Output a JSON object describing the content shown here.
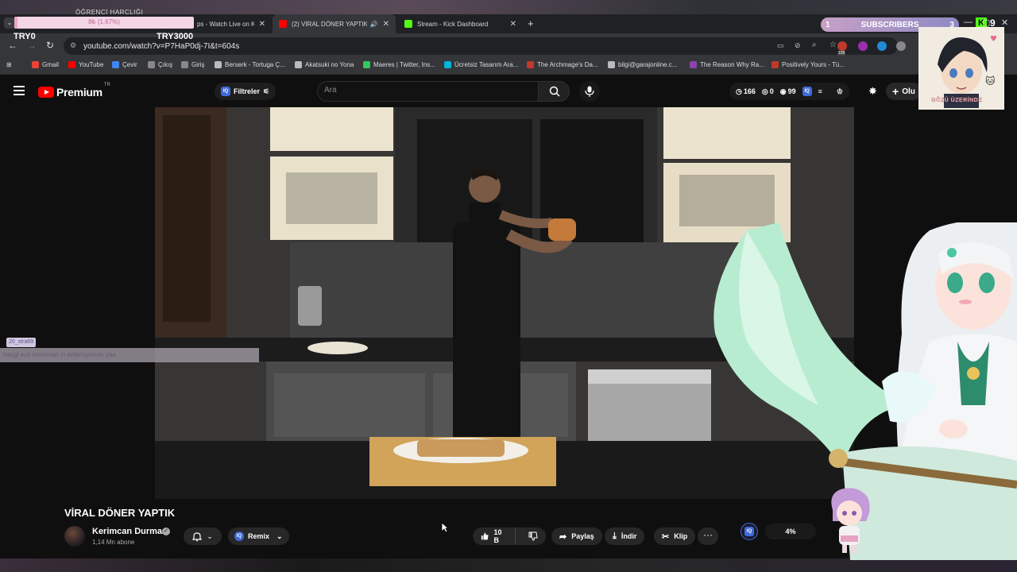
{
  "overlay": {
    "donation_title": "ÖĞRENCİ HARÇLIĞI",
    "progress_text": "8₺ (1.67%)",
    "progress_percent": 1.67,
    "goal_left": "TRY0",
    "goal_right": "TRY3000",
    "subscribers_label": "SUBSCRIBERS",
    "subscribers_left": "1",
    "subscribers_right": "3",
    "kick_count": "9",
    "cam_caption": "GÖZÜ ÜZERİNDE"
  },
  "browser": {
    "tabs": [
      {
        "label": "ps - Watch Live on K",
        "favicon_color": "#53fc18"
      },
      {
        "label": "(2) VİRAL DÖNER YAPTIK -",
        "favicon_color": "#ff0000",
        "active": true
      },
      {
        "label": "Stream - Kick Dashboard",
        "favicon_color": "#53fc18"
      }
    ],
    "url": "youtube.com/watch?v=P7HaP0dj-7I&t=604s",
    "extension_badge": "105",
    "bookmarks": [
      {
        "label": "Gmail",
        "color": "#ea4335"
      },
      {
        "label": "YouTube",
        "color": "#ff0000"
      },
      {
        "label": "Çevir",
        "color": "#4285f4"
      },
      {
        "label": "Çıkış",
        "color": "#888888"
      },
      {
        "label": "Giriş",
        "color": "#888888"
      },
      {
        "label": "Berserk - Tortuga Ç...",
        "color": "#bbbbbb"
      },
      {
        "label": "Akatsuki no Yona",
        "color": "#bbbbbb"
      },
      {
        "label": "Maeres | Twitter, Ins...",
        "color": "#32c85a"
      },
      {
        "label": "Ücretsiz Tasarım Ara...",
        "color": "#00b4d8"
      },
      {
        "label": "The Archmage's Da...",
        "color": "#c0392b"
      },
      {
        "label": "bilgi@garajonline.c...",
        "color": "#bbbbbb"
      },
      {
        "label": "The Reason Why Ra...",
        "color": "#8e44ad"
      },
      {
        "label": "Positively Yours - Tü...",
        "color": "#c0392b"
      }
    ]
  },
  "youtube": {
    "logo_text": "Premium",
    "region": "TR",
    "filters_label": "Filtreler",
    "search_placeholder": "Ara",
    "stats": {
      "views": "166",
      "zero": "0",
      "eye": "99"
    },
    "create_label": "Olu",
    "video_title": "VİRAL DÖNER YAPTIK",
    "channel_name": "Kerimcan Durmaz",
    "subscriber_count": "1,14 Mn abone",
    "remix_label": "Remix",
    "like_count": "10 B",
    "share_label": "Paylaş",
    "download_label": "İndir",
    "clip_label": "Klip",
    "percent_label": "4%"
  },
  "chat": {
    "user": "20_xtra69",
    "message": "hangi ece kerimcan ın anlamıyorum yaa"
  }
}
